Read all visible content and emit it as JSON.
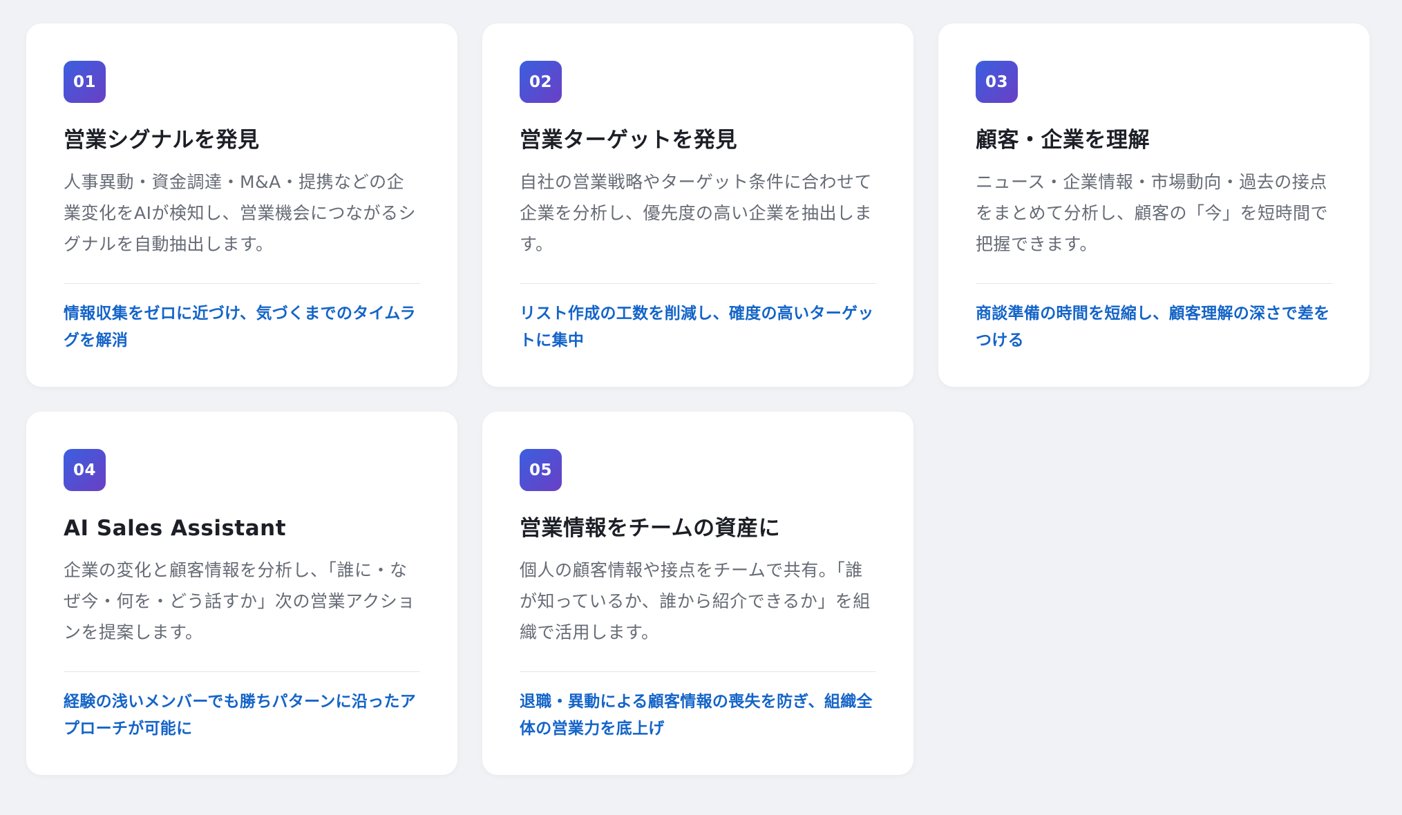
{
  "cards": [
    {
      "number": "01",
      "title": "営業シグナルを発見",
      "description": "人事異動・資金調達・M&A・提携などの企業変化をAIが検知し、営業機会につながるシグナルを自動抽出します。",
      "benefit": "情報収集をゼロに近づけ、気づくまでのタイムラグを解消"
    },
    {
      "number": "02",
      "title": "営業ターゲットを発見",
      "description": "自社の営業戦略やターゲット条件に合わせて企業を分析し、優先度の高い企業を抽出します。",
      "benefit": "リスト作成の工数を削減し、確度の高いターゲットに集中"
    },
    {
      "number": "03",
      "title": "顧客・企業を理解",
      "description": "ニュース・企業情報・市場動向・過去の接点をまとめて分析し、顧客の「今」を短時間で把握できます。",
      "benefit": "商談準備の時間を短縮し、顧客理解の深さで差をつける"
    },
    {
      "number": "04",
      "title": "AI Sales Assistant",
      "description": "企業の変化と顧客情報を分析し、「誰に・なぜ今・何を・どう話すか」次の営業アクションを提案します。",
      "benefit": "経験の浅いメンバーでも勝ちパターンに沿ったアプローチが可能に"
    },
    {
      "number": "05",
      "title": "営業情報をチームの資産に",
      "description": "個人の顧客情報や接点をチームで共有。「誰が知っているか、誰から紹介できるか」を組織で活用します。",
      "benefit": "退職・異動による顧客情報の喪失を防ぎ、組織全体の営業力を底上げ"
    }
  ]
}
